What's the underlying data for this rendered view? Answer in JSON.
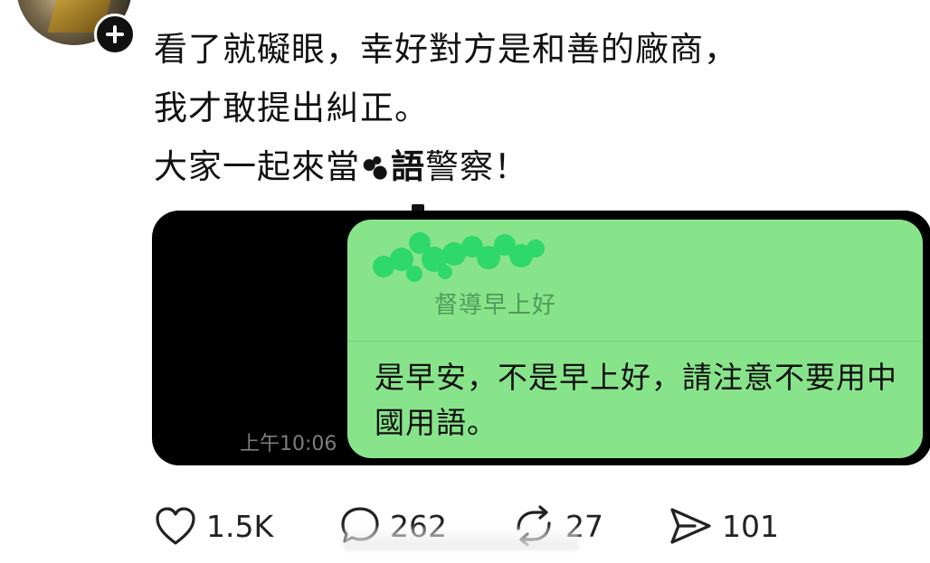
{
  "post": {
    "line1": "看了就礙眼，幸好對方是和善的廠商，",
    "line2": "我才敢提出糾正。",
    "line3_prefix": "大家一起來當",
    "line3_bold": "語",
    "line3_suffix": "警察！"
  },
  "chat": {
    "quoted_message": "督導早上好",
    "message": "是早安，不是早上好，請注意不要用中國用語。",
    "timestamp": "上午10:06",
    "bubble_color": "#88e48a"
  },
  "actions": {
    "likes": "1.5K",
    "replies": "262",
    "reposts": "27",
    "shares": "101"
  },
  "icons": [
    "plus-icon",
    "heart-icon",
    "comment-icon",
    "repost-icon",
    "send-icon"
  ]
}
